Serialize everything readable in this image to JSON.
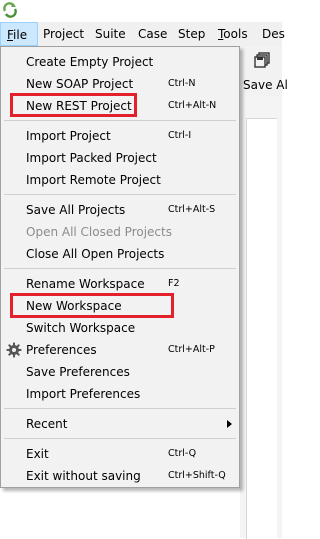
{
  "menubar": {
    "items": [
      {
        "label": "File",
        "underline": "F"
      },
      {
        "label": "Project"
      },
      {
        "label": "Suite"
      },
      {
        "label": "Case"
      },
      {
        "label": "Step"
      },
      {
        "label": "Tools",
        "underline": "T"
      },
      {
        "label": "Des"
      }
    ]
  },
  "background": {
    "toolbar_label": "Save Al"
  },
  "file_menu": {
    "items": [
      {
        "label": "Create Empty Project",
        "shortcut": "",
        "disabled": false
      },
      {
        "label": "New SOAP Project",
        "shortcut": "Ctrl-N",
        "disabled": false
      },
      {
        "label": "New REST Project",
        "shortcut": "Ctrl+Alt-N",
        "disabled": false,
        "highlighted": true
      },
      {
        "label": "Import Project",
        "shortcut": "Ctrl-I",
        "disabled": false
      },
      {
        "label": "Import Packed Project",
        "shortcut": "",
        "disabled": false
      },
      {
        "label": "Import Remote Project",
        "shortcut": "",
        "disabled": false
      },
      {
        "label": "Save All Projects",
        "shortcut": "Ctrl+Alt-S",
        "disabled": false
      },
      {
        "label": "Open All Closed Projects",
        "shortcut": "",
        "disabled": true
      },
      {
        "label": "Close All Open Projects",
        "shortcut": "",
        "disabled": false
      },
      {
        "label": "Rename Workspace",
        "shortcut": "F2",
        "disabled": false
      },
      {
        "label": "New Workspace",
        "shortcut": "",
        "disabled": false,
        "highlighted": true
      },
      {
        "label": "Switch Workspace",
        "shortcut": "",
        "disabled": false
      },
      {
        "label": "Preferences",
        "shortcut": "Ctrl+Alt-P",
        "disabled": false,
        "icon": "gear-icon"
      },
      {
        "label": "Save Preferences",
        "shortcut": "",
        "disabled": false
      },
      {
        "label": "Import Preferences",
        "shortcut": "",
        "disabled": false
      },
      {
        "label": "Recent",
        "shortcut": "",
        "disabled": false,
        "submenu": true
      },
      {
        "label": "Exit",
        "shortcut": "Ctrl-Q",
        "disabled": false
      },
      {
        "label": "Exit without saving",
        "shortcut": "Ctrl+Shift-Q",
        "disabled": false
      }
    ]
  },
  "colors": {
    "highlight_box": "#e3202b",
    "menu_background": "#f2f2f2",
    "active_menu": "#cce8ff"
  }
}
